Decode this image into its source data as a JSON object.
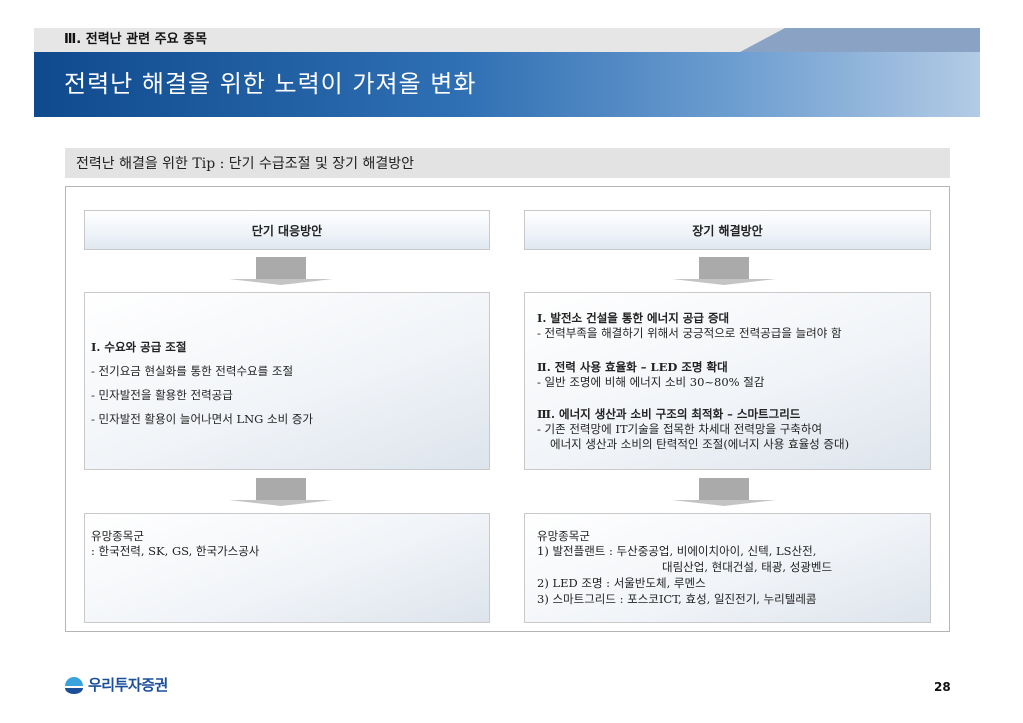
{
  "header": {
    "section": "Ⅲ. 전력난 관련 주요 종목",
    "title": "전력난 해결을 위한 노력이 가져올 변화"
  },
  "tip": "전력난 해결을 위한 Tip : 단기 수급조절 및 장기 해결방안",
  "left": {
    "heading": "단기 대응방안",
    "measures": [
      "I. 수요와 공급 조절",
      "- 전기요금 현실화를 통한 전력수요를 조절",
      "- 민자발전을 활용한 전력공급",
      "- 민자발전 활용이 늘어나면서 LNG 소비 증가"
    ],
    "stocks": [
      "유망종목군",
      ": 한국전력, SK, GS, 한국가스공사"
    ]
  },
  "right": {
    "heading": "장기 해결방안",
    "measures": [
      "Ⅰ. 발전소 건설을 통한 에너지 공급 증대",
      "- 전력부족을 해결하기 위해서 궁긍적으로 전력공급을 늘려야 함",
      "Ⅱ. 전력 사용 효율화 – LED 조명 확대",
      "- 일반 조명에 비해 에너지 소비 30~80% 절감",
      "Ⅲ. 에너지 생산과 소비 구조의 최적화 – 스마트그리드",
      "- 기존 전력망에 IT기술을 접목한 차세대 전력망을 구축하여",
      "에너지 생산과 소비의 탄력적인 조절(에너지 사용 효율성 증대)"
    ],
    "stocks": [
      "유망종목군",
      "1) 발전플랜트 : 두산중공업, 비에이치아이, 신텍, LS산전,",
      "대림산업, 현대건설, 태광, 성광벤드",
      "2) LED 조명 : 서울반도체, 루멘스",
      "3) 스마트그리드 : 포스코ICT, 효성, 일진전기, 누리텔레콤"
    ]
  },
  "footer": {
    "logo": "우리투자증권",
    "page": "28"
  },
  "colors": {
    "title_band": "#0f4a8d",
    "logo": "#1b4f9a"
  }
}
